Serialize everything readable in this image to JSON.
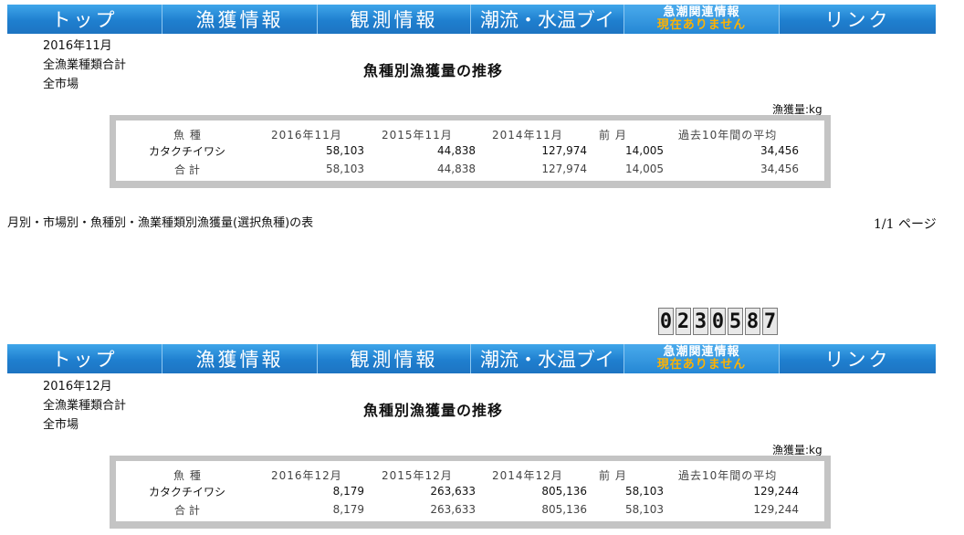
{
  "nav": [
    "トップ",
    "漁獲情報",
    "観測情報",
    "潮流・水温ブイ",
    "リンク"
  ],
  "alert": {
    "line1": "急潮関連情報",
    "line2": "現在ありません"
  },
  "pages": [
    {
      "date": "2016年11月",
      "sector": "全漁業種類合計",
      "market": "全市場",
      "title": "魚種別漁獲量の推移",
      "unit": "漁獲量:kg",
      "headers": [
        "魚 種",
        "2016年11月",
        "2015年11月",
        "2014年11月",
        "前 月",
        "過去10年間の平均"
      ],
      "row": {
        "species": "カタクチイワシ",
        "values": [
          "58,103",
          "44,838",
          "127,974",
          "14,005",
          "34,456"
        ]
      },
      "total": {
        "label": "合 計",
        "values": [
          "58,103",
          "44,838",
          "127,974",
          "14,005",
          "34,456"
        ]
      }
    },
    {
      "date": "2016年12月",
      "sector": "全漁業種類合計",
      "market": "全市場",
      "title": "魚種別漁獲量の推移",
      "unit": "漁獲量:kg",
      "headers": [
        "魚 種",
        "2016年12月",
        "2015年12月",
        "2014年12月",
        "前 月",
        "過去10年間の平均"
      ],
      "row": {
        "species": "カタクチイワシ",
        "values": [
          "8,179",
          "263,633",
          "805,136",
          "58,103",
          "129,244"
        ]
      },
      "total": {
        "label": "合 計",
        "values": [
          "8,179",
          "263,633",
          "805,136",
          "58,103",
          "129,244"
        ]
      }
    }
  ],
  "caption": "月別・市場別・魚種別・漁業種類別漁獲量(選択魚種)の表",
  "pager": "1/1 ページ",
  "counter": [
    "0",
    "2",
    "3",
    "0",
    "5",
    "8",
    "7"
  ],
  "colors": {
    "nav_blue": "#1f7fcf",
    "alert_orange": "#ffb200",
    "table_frame": "#c4c4c4"
  }
}
